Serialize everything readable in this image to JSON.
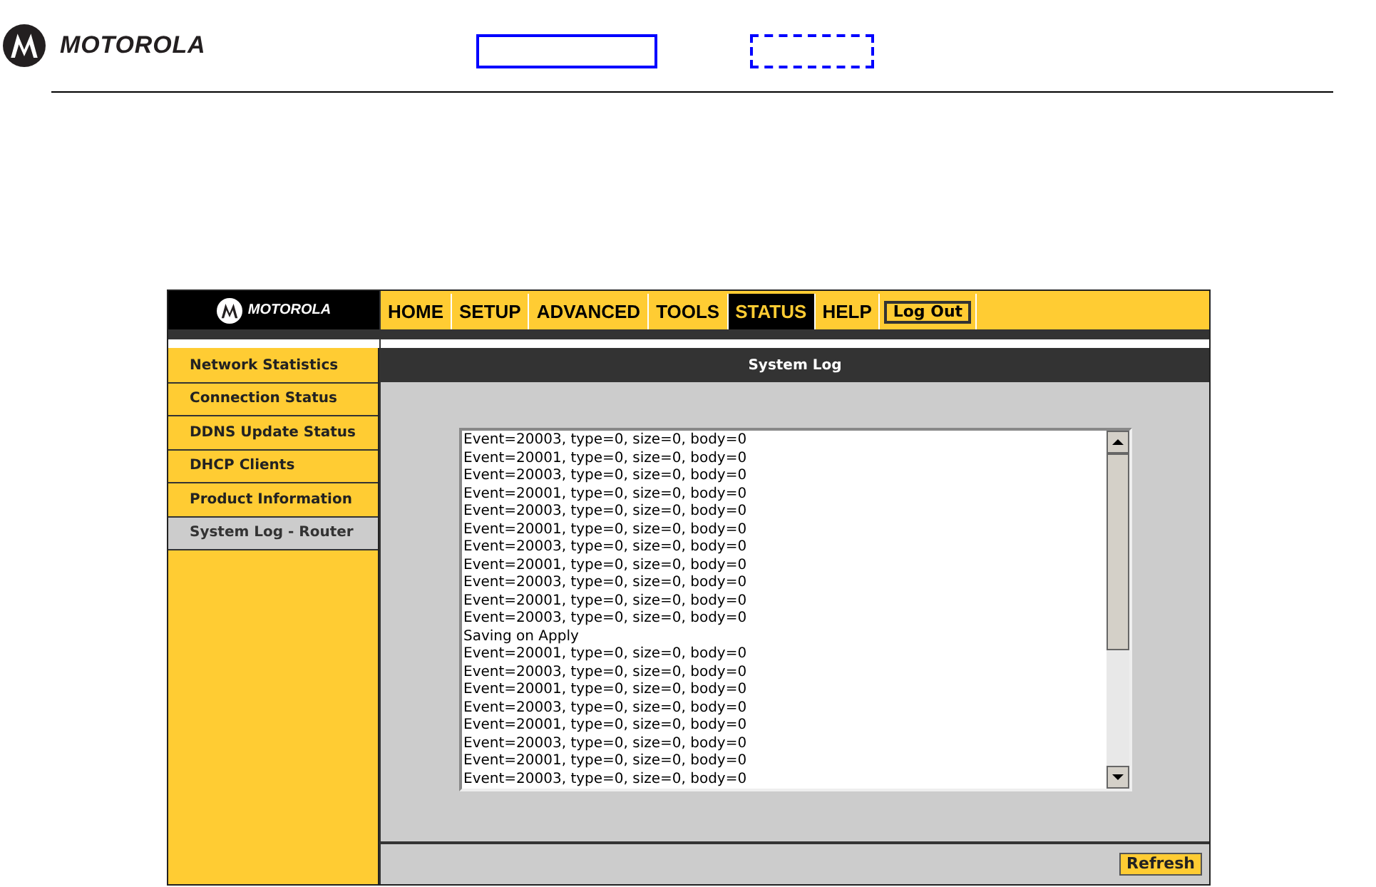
{
  "header": {
    "brand": "MOTOROLA"
  },
  "router": {
    "brand": "MOTOROLA",
    "tabs": [
      {
        "label": "HOME",
        "selected": false
      },
      {
        "label": "SETUP",
        "selected": false
      },
      {
        "label": "ADVANCED",
        "selected": false
      },
      {
        "label": "TOOLS",
        "selected": false
      },
      {
        "label": "STATUS",
        "selected": true
      },
      {
        "label": "HELP",
        "selected": false
      }
    ],
    "logout_button": "Log Out",
    "sidebar": {
      "items": [
        {
          "label": "Network Statistics",
          "selected": false
        },
        {
          "label": "Connection Status",
          "selected": false
        },
        {
          "label": "DDNS Update Status",
          "selected": false
        },
        {
          "label": "DHCP Clients",
          "selected": false
        },
        {
          "label": "Product Information",
          "selected": false
        },
        {
          "label": "System Log - Router",
          "selected": true
        }
      ]
    },
    "panel_title": "System Log",
    "log_lines": [
      "Event=20003, type=0, size=0, body=0",
      "Event=20001, type=0, size=0, body=0",
      "Event=20003, type=0, size=0, body=0",
      "Event=20001, type=0, size=0, body=0",
      "Event=20003, type=0, size=0, body=0",
      "Event=20001, type=0, size=0, body=0",
      "Event=20003, type=0, size=0, body=0",
      "Event=20001, type=0, size=0, body=0",
      "Event=20003, type=0, size=0, body=0",
      "Event=20001, type=0, size=0, body=0",
      "Event=20003, type=0, size=0, body=0",
      "Saving on Apply",
      "Event=20001, type=0, size=0, body=0",
      "Event=20003, type=0, size=0, body=0",
      "Event=20001, type=0, size=0, body=0",
      "Event=20003, type=0, size=0, body=0",
      "Event=20001, type=0, size=0, body=0",
      "Event=20003, type=0, size=0, body=0",
      "Event=20001, type=0, size=0, body=0",
      "Event=20003, type=0, size=0, body=0"
    ],
    "refresh_button": "Refresh"
  }
}
